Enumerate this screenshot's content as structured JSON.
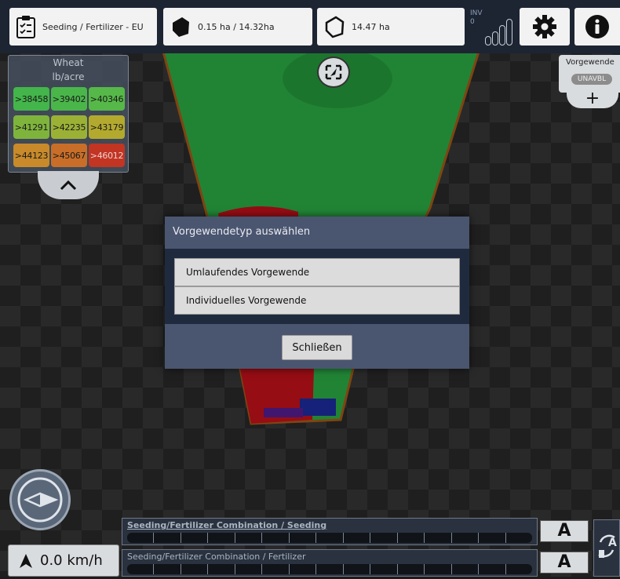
{
  "topbar": {
    "product_label": "Seeding / Fertilizer - EU",
    "area_label": "0.15 ha / 14.32ha",
    "field_area_label": "14.47 ha",
    "inv_label": "INV",
    "inv_value": "0",
    "settings_icon": "gear-icon",
    "info_icon": "info-icon"
  },
  "legend": {
    "crop": "Wheat",
    "unit": "lb/acre",
    "cells": [
      {
        "label": ">38458",
        "color": "#43b54a"
      },
      {
        "label": ">39402",
        "color": "#4ab64a"
      },
      {
        "label": ">40346",
        "color": "#56b848"
      },
      {
        "label": ">41291",
        "color": "#7fb43c"
      },
      {
        "label": ">42235",
        "color": "#9ab135"
      },
      {
        "label": ">43179",
        "color": "#b3a92e"
      },
      {
        "label": ">44123",
        "color": "#c88a2a"
      },
      {
        "label": ">45067",
        "color": "#c86e28"
      },
      {
        "label": ">46012",
        "color": "#c23522"
      }
    ]
  },
  "headland": {
    "label": "Vorgewende",
    "status": "UNAVBL",
    "add_symbol": "+"
  },
  "dialog": {
    "title": "Vorgewendetyp auswählen",
    "options": [
      "Umlaufendes Vorgewende",
      "Individuelles Vorgewende"
    ],
    "close_label": "Schließen"
  },
  "speed": {
    "value": "0.0 km/h"
  },
  "sections": [
    {
      "label": "Seeding/Fertilizer Combination / Seeding",
      "mode": "A"
    },
    {
      "label": "Seeding/Fertilizer Combination / Fertilizer",
      "mode": "A"
    }
  ],
  "colors": {
    "field_green": "#2fb84a",
    "field_red": "#d0121c",
    "field_blue": "#1f2fa8",
    "boundary": "#b0601a",
    "dialog_bg": "#4a5570"
  }
}
